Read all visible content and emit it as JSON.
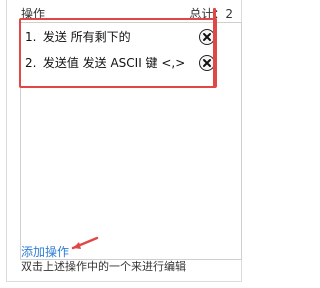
{
  "header": {
    "title": "操作",
    "total": "总计：2"
  },
  "actions": [
    {
      "index": "1.",
      "label": "发送 所有剩下的"
    },
    {
      "index": "2.",
      "label": "发送值 发送 ASCII 键 <,>"
    }
  ],
  "add_action_label": "添加操作",
  "hint": "双击上述操作中的一个来进行编辑",
  "colors": {
    "annotation_red": "#e04848",
    "link_blue": "#2f7fd6"
  },
  "icons": {
    "remove": "close-circle-icon",
    "annotation_arrow": "arrow-icon"
  }
}
